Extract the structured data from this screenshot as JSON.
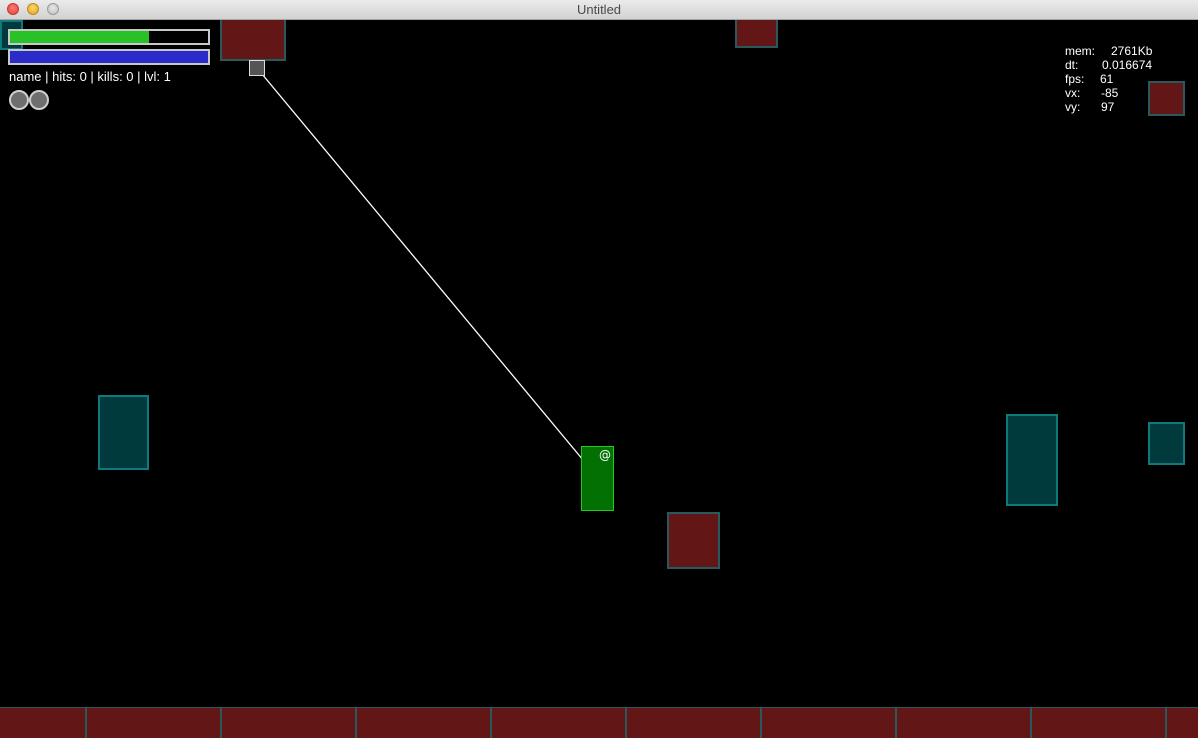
{
  "window": {
    "title": "Untitled"
  },
  "hud": {
    "health": 0.7,
    "energy": 1.0,
    "health_color": "#28c228",
    "energy_color": "#2b2bc9",
    "status_line": "name | hits: 0 | kills: 0 | lvl: 1",
    "lives": 2
  },
  "stats": {
    "mem_label": "mem:",
    "mem_value": "2761Kb",
    "dt_label": "dt:",
    "dt_value": "0.016674",
    "fps_label": "fps:",
    "fps_value": "61",
    "vx_label": "vx:",
    "vx_value": "-85",
    "vy_label": "vy:",
    "vy_value": "97"
  },
  "player": {
    "glyph": "@"
  },
  "colors": {
    "background": "#000000",
    "red_block": "#621616",
    "teal_block": "#003a3d",
    "player": "#027002",
    "rope": "#ffffff"
  }
}
